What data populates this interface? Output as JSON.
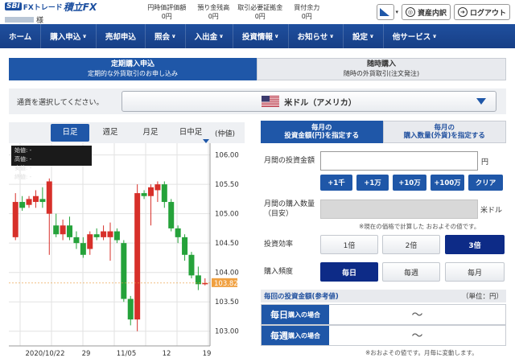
{
  "logo": {
    "sbi": "SBI",
    "fx_trade": "FXトレード",
    "tsumitate": "積立FX",
    "user_suffix": "様"
  },
  "stats": [
    {
      "label": "円時価評価額",
      "value": "0円"
    },
    {
      "label": "預り金残高",
      "value": "0円"
    },
    {
      "label": "取引必要証拠金",
      "value": "0円"
    },
    {
      "label": "買付余力",
      "value": "0円"
    }
  ],
  "header_buttons": {
    "assets": "資産内訳",
    "logout": "ログアウト"
  },
  "nav": [
    {
      "label": "ホーム",
      "caret": false
    },
    {
      "label": "購入申込",
      "caret": true
    },
    {
      "label": "売却申込",
      "caret": false
    },
    {
      "label": "照会",
      "caret": true
    },
    {
      "label": "入出金",
      "caret": true
    },
    {
      "label": "投資情報",
      "caret": true
    },
    {
      "label": "お知らせ",
      "caret": true
    },
    {
      "label": "設定",
      "caret": true
    },
    {
      "label": "他サービス",
      "caret": true
    }
  ],
  "main_tabs": [
    {
      "title": "定期購入申込",
      "sub": "定期的な外貨取引のお申し込み"
    },
    {
      "title": "随時購入",
      "sub": "随時の外貨取引(注文発注)"
    }
  ],
  "currency": {
    "label": "通貨を選択してください。",
    "selected": "米ドル（アメリカ）"
  },
  "chart_tabs": [
    "日足",
    "週足",
    "月足",
    "日中足"
  ],
  "chart_unit": "(仲値)",
  "chart_info": {
    "start": "始値: -",
    "high": "高値: -",
    "low": "安値: -",
    "close": "終値: -"
  },
  "chart_data": {
    "type": "candlestick",
    "x_ticks": [
      "2020/10/22",
      "29",
      "11/05",
      "12",
      "19"
    ],
    "y_ticks": [
      106.0,
      105.5,
      105.0,
      104.5,
      104.0,
      103.5,
      103.0
    ],
    "ylim": [
      102.75,
      106.2
    ],
    "current_price": "103.82",
    "candles": [
      {
        "o": 104.6,
        "c": 105.2,
        "h": 105.35,
        "l": 104.55
      },
      {
        "o": 105.2,
        "c": 105.1,
        "h": 105.3,
        "l": 105.05
      },
      {
        "o": 105.15,
        "c": 105.25,
        "h": 105.3,
        "l": 105.1
      },
      {
        "o": 105.2,
        "c": 105.3,
        "h": 105.4,
        "l": 105.1
      },
      {
        "o": 105.25,
        "c": 105.2,
        "h": 105.45,
        "l": 105.1
      },
      {
        "o": 105.0,
        "c": 105.55,
        "h": 105.6,
        "l": 104.3
      },
      {
        "o": 104.8,
        "c": 104.65,
        "h": 105.0,
        "l": 104.6
      },
      {
        "o": 104.65,
        "c": 104.8,
        "h": 104.9,
        "l": 104.55
      },
      {
        "o": 104.8,
        "c": 104.6,
        "h": 104.95,
        "l": 104.55
      },
      {
        "o": 104.6,
        "c": 104.5,
        "h": 104.7,
        "l": 104.4
      },
      {
        "o": 104.5,
        "c": 104.3,
        "h": 104.6,
        "l": 104.25
      },
      {
        "o": 104.4,
        "c": 104.65,
        "h": 104.7,
        "l": 104.3
      },
      {
        "o": 104.65,
        "c": 104.6,
        "h": 104.75,
        "l": 104.55
      },
      {
        "o": 104.6,
        "c": 104.7,
        "h": 104.8,
        "l": 104.55
      },
      {
        "o": 104.6,
        "c": 104.7,
        "h": 104.85,
        "l": 104.2
      },
      {
        "o": 104.7,
        "c": 104.55,
        "h": 104.75,
        "l": 104.5
      },
      {
        "o": 104.5,
        "c": 103.55,
        "h": 104.55,
        "l": 103.5
      },
      {
        "o": 103.55,
        "c": 103.2,
        "h": 103.6,
        "l": 103.1
      },
      {
        "o": 103.2,
        "c": 105.35,
        "h": 105.5,
        "l": 103.0
      },
      {
        "o": 105.35,
        "c": 105.3,
        "h": 105.4,
        "l": 105.25
      },
      {
        "o": 105.3,
        "c": 105.45,
        "h": 105.5,
        "l": 104.8
      },
      {
        "o": 105.4,
        "c": 105.5,
        "h": 105.55,
        "l": 105.2
      },
      {
        "o": 105.5,
        "c": 105.2,
        "h": 105.55,
        "l": 105.1
      },
      {
        "o": 105.2,
        "c": 104.75,
        "h": 105.25,
        "l": 104.7
      },
      {
        "o": 104.75,
        "c": 104.6,
        "h": 104.8,
        "l": 104.5
      },
      {
        "o": 104.6,
        "c": 104.3,
        "h": 104.65,
        "l": 104.2
      },
      {
        "o": 104.3,
        "c": 103.95,
        "h": 104.35,
        "l": 103.9
      },
      {
        "o": 103.95,
        "c": 103.8,
        "h": 104.1,
        "l": 103.7
      },
      {
        "o": 103.8,
        "c": 103.82,
        "h": 103.9,
        "l": 103.78
      }
    ]
  },
  "right_tabs": [
    {
      "line1": "毎月の",
      "line2": "投資金額(円)を指定する"
    },
    {
      "line1": "毎月の",
      "line2": "購入数量(外貨)を指定する"
    }
  ],
  "form": {
    "amount_label": "月間の投資金額",
    "amount_unit": "円",
    "quick_buttons": [
      "+1千",
      "+1万",
      "+10万",
      "+100万",
      "クリア"
    ],
    "qty_label": "月間の購入数量",
    "qty_sub": "（目安）",
    "qty_unit": "米ドル",
    "qty_note": "※現在の価格で計算した おおよその値です。",
    "leverage_label": "投資効率",
    "leverage_options": [
      "1倍",
      "2倍",
      "3倍"
    ],
    "leverage_selected": "3倍",
    "freq_label": "購入頻度",
    "freq_options": [
      "毎日",
      "毎週",
      "毎月"
    ],
    "freq_selected": "毎日"
  },
  "reference": {
    "title": "毎回の投資金額(参考値)",
    "unit": "（単位：円）",
    "rows": [
      {
        "label": "毎日",
        "suffix": "購入の場合",
        "value": "～"
      },
      {
        "label": "毎週",
        "suffix": "購入の場合",
        "value": "～"
      }
    ],
    "note": "※おおよその値です。月毎に変動します。"
  }
}
